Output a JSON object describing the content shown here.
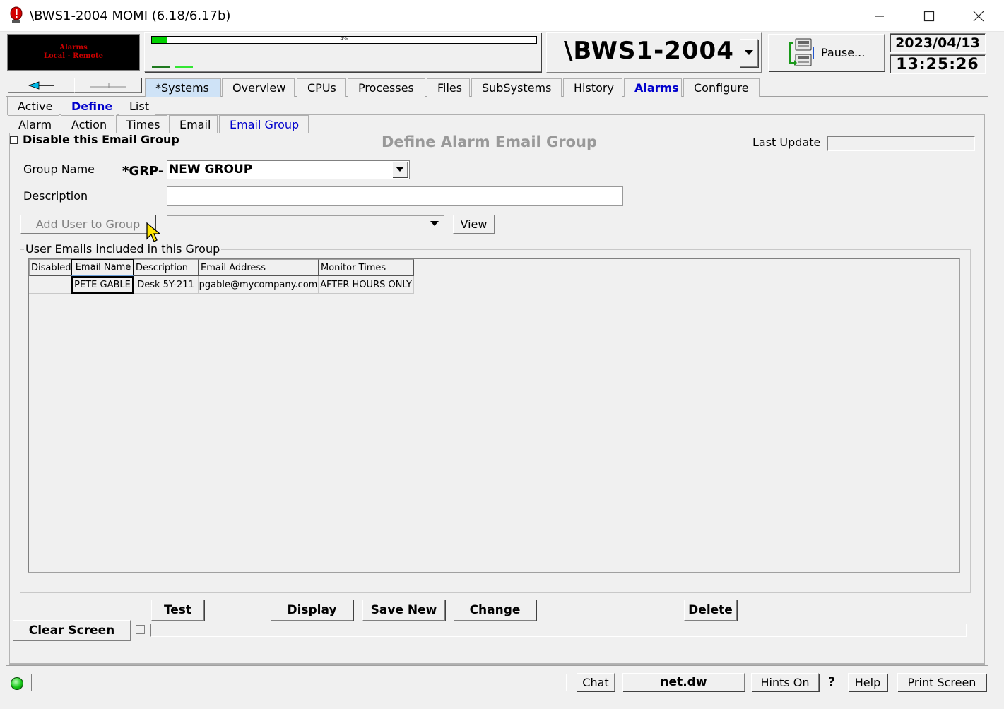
{
  "window": {
    "title": "\\BWS1-2004 MOMI (6.18/6.17b)",
    "controls": {
      "minimize_icon": "minimize-icon",
      "maximize_icon": "maximize-icon",
      "close_icon": "close-icon"
    }
  },
  "header": {
    "alarm_line1": "Alarms",
    "alarm_line2": "Local - Remote",
    "cpu_percent_label": "4%",
    "cpu_percent_value": 4,
    "system_name": "\\BWS1-2004",
    "pause_label": "Pause...",
    "date": "2023/04/13",
    "time": "13:25:26"
  },
  "main_tabs": [
    {
      "label": "*Systems",
      "selected": true
    },
    {
      "label": "Overview"
    },
    {
      "label": "CPUs"
    },
    {
      "label": "Processes"
    },
    {
      "label": "Files"
    },
    {
      "label": "SubSystems"
    },
    {
      "label": "History"
    },
    {
      "label": "Alarms",
      "active": true
    },
    {
      "label": "Configure"
    }
  ],
  "sub_tabs": [
    {
      "label": "Active"
    },
    {
      "label": "Define",
      "active": true
    },
    {
      "label": "List"
    }
  ],
  "define_tabs": [
    {
      "label": "Alarm"
    },
    {
      "label": "Action"
    },
    {
      "label": "Times"
    },
    {
      "label": "Email"
    },
    {
      "label": "Email Group",
      "active": true
    }
  ],
  "form": {
    "disable_label": "Disable this Email Group",
    "section_title": "Define Alarm Email Group",
    "last_update_label": "Last Update",
    "last_update_value": "",
    "group_name_label": "Group Name",
    "group_prefix": "*GRP-",
    "group_name_value": "NEW GROUP",
    "description_label": "Description",
    "description_value": "",
    "add_user_button": "Add User to Group",
    "user_select_value": "",
    "view_button": "View",
    "group_box_title": "User Emails included in this Group"
  },
  "table": {
    "columns": [
      "Disabled",
      "Email Name",
      "Description",
      "Email Address",
      "Monitor Times"
    ],
    "rows": [
      [
        "",
        "PETE GABLE",
        "Desk 5Y-211",
        "pgable@mycompany.com",
        "AFTER HOURS ONLY"
      ]
    ]
  },
  "actions": {
    "test": "Test",
    "display": "Display",
    "save_new": "Save New",
    "change": "Change",
    "delete": "Delete",
    "clear_screen": "Clear Screen"
  },
  "status_bar": {
    "chat": "Chat",
    "host": "net.dw",
    "hints": "Hints On",
    "question": "?",
    "help": "Help",
    "print_screen": "Print Screen"
  },
  "colors": {
    "accent": "#0000cc",
    "alarm_text": "#c80000",
    "cpu_bar": "#00d000",
    "section_title": "#999999"
  }
}
